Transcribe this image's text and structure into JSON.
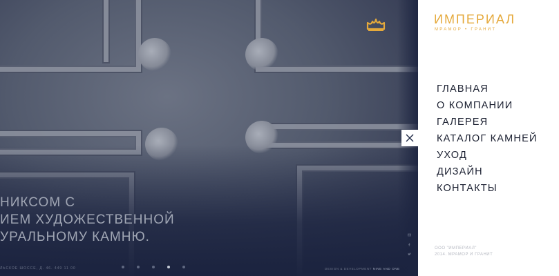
{
  "hero": {
    "tagline_lines": [
      "НИКСОМ С",
      "ИЕМ ХУДОЖЕСТВЕННОЙ",
      "УРАЛЬНОМУ КАМНЮ."
    ],
    "address": "ЛЬСКОЕ ШОССЕ, Д. 46. 449 11 00",
    "slider_dots": 5,
    "active_dot": 4,
    "credits_prefix": "DESIGN & DEVELOPMENT",
    "credits_studio": "NINE AND ONE",
    "crown_icon": "crown-icon",
    "social_icons": [
      "mail-icon",
      "facebook-icon",
      "twitter-icon"
    ]
  },
  "close_button": {
    "icon": "close-icon"
  },
  "brand": {
    "title": "ИМПЕРИАЛ",
    "subtitle": "МРАМОР • ГРАНИТ",
    "accent_color": "#e5a93b"
  },
  "nav": {
    "items": [
      {
        "label": "ГЛАВНАЯ"
      },
      {
        "label": "О КОМПАНИИ"
      },
      {
        "label": "ГАЛЕРЕЯ"
      },
      {
        "label": "КАТАЛОГ КАМНЕЙ"
      },
      {
        "label": "УХОД"
      },
      {
        "label": "ДИЗАЙН"
      },
      {
        "label": "КОНТАКТЫ"
      }
    ]
  },
  "company": {
    "line1": "ООО \"ИМПЕРИАЛ\"",
    "line2": "2014. МРАМОР И ГРАНИТ"
  }
}
